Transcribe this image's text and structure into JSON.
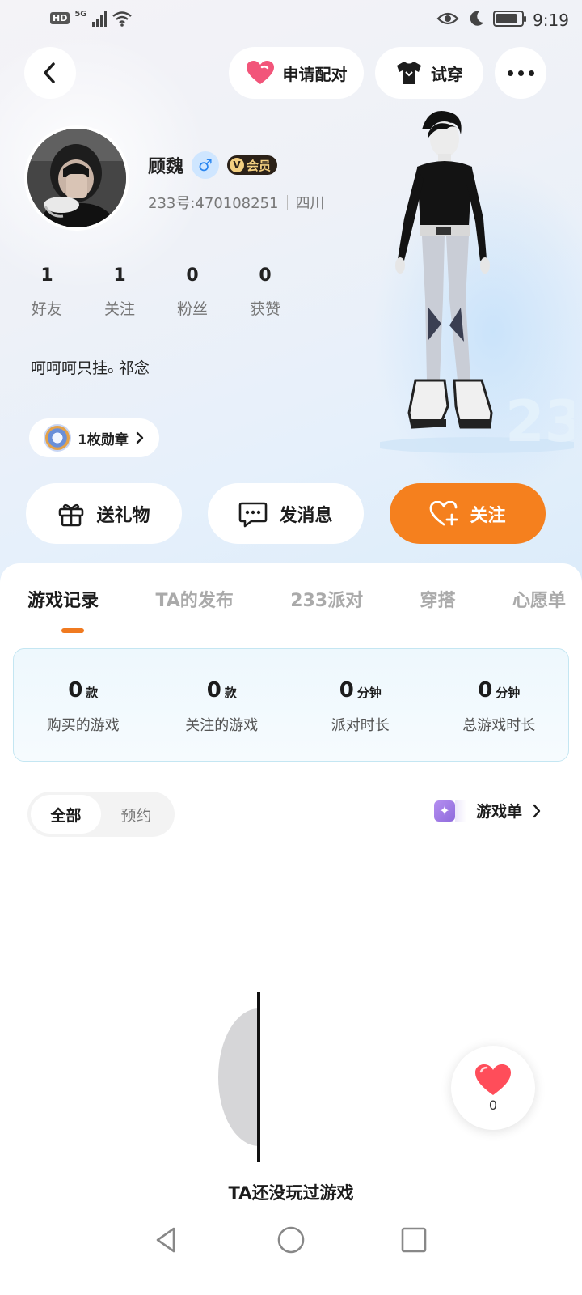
{
  "status_bar": {
    "hd": "HD",
    "signal": "5G",
    "time": "9:19"
  },
  "topbar": {
    "pair_label": "申请配对",
    "tryon_label": "试穿"
  },
  "profile": {
    "name": "顾魏",
    "gender_symbol": "♂",
    "vip_label": "会员",
    "vip_letter": "V",
    "id_text": "233号:470108251",
    "location": "四川",
    "stats": [
      {
        "value": "1",
        "label": "好友"
      },
      {
        "value": "1",
        "label": "关注"
      },
      {
        "value": "0",
        "label": "粉丝"
      },
      {
        "value": "0",
        "label": "获赞"
      }
    ],
    "bio": "呵呵呵只挂ₒ 祁念",
    "medal_label": "1枚勋章"
  },
  "actions": {
    "gift": "送礼物",
    "message": "发消息",
    "follow": "关注"
  },
  "tabs": [
    {
      "label": "游戏记录",
      "active": true
    },
    {
      "label": "TA的发布"
    },
    {
      "label": "233派对"
    },
    {
      "label": "穿搭"
    },
    {
      "label": "心愿单"
    }
  ],
  "summary": [
    {
      "num": "0",
      "unit": "款",
      "label": "购买的游戏"
    },
    {
      "num": "0",
      "unit": "款",
      "label": "关注的游戏"
    },
    {
      "num": "0",
      "unit": "分钟",
      "label": "派对时长"
    },
    {
      "num": "0",
      "unit": "分钟",
      "label": "总游戏时长"
    }
  ],
  "filter": {
    "all": "全部",
    "reserve": "预约"
  },
  "game_list_label": "游戏单",
  "empty_text": "TA还没玩过游戏",
  "likes": "0",
  "colors": {
    "accent_orange": "#f5801e",
    "pink_heart": "#f2557a",
    "indicator": "#f07a20"
  }
}
